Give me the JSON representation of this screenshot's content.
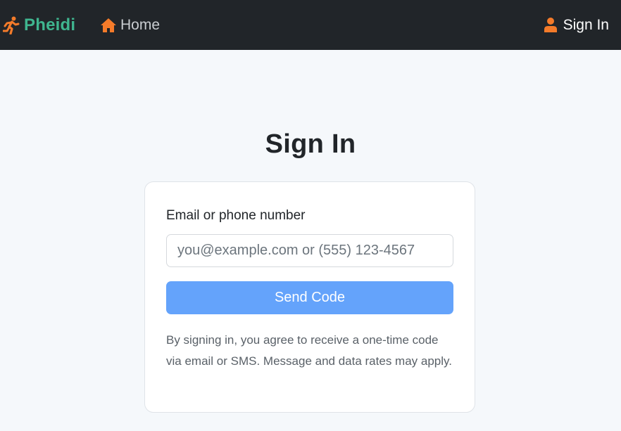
{
  "navbar": {
    "brand": {
      "icon": "running-person-icon",
      "label": "Pheidi"
    },
    "home": {
      "icon": "house-icon",
      "label": "Home"
    },
    "signin": {
      "icon": "user-icon",
      "label": "Sign In"
    }
  },
  "page": {
    "title": "Sign In"
  },
  "form": {
    "label": "Email or phone number",
    "input_value": "",
    "input_placeholder": "you@example.com or (555) 123-4567",
    "button_label": "Send Code",
    "disclaimer": "By signing in, you agree to receive a one-time code via email or SMS. Message and data rates may apply."
  },
  "colors": {
    "navbar_bg": "#212529",
    "brand_green": "#3fb58f",
    "accent_orange": "#f47b2a",
    "button_blue": "#64a3fb",
    "page_bg": "#f5f8fb"
  }
}
